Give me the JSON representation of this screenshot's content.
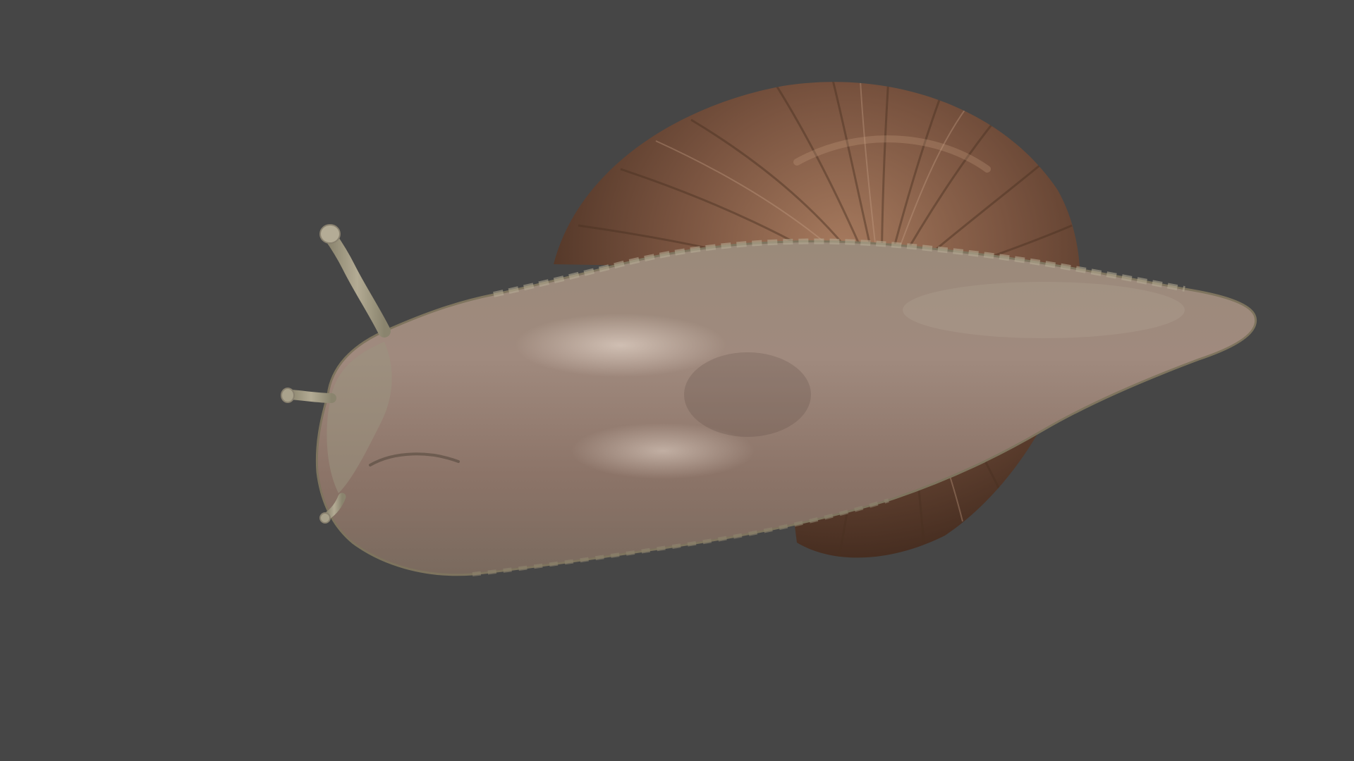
{
  "scene": {
    "subject": "snail-render",
    "colors": {
      "background": "#464646",
      "shell_base": "#6e4a36",
      "shell_light": "#a67a5e",
      "shell_dark": "#3f281c",
      "body_base": "#8e7a6e",
      "body_light": "#bba89a",
      "body_edge": "#9c9480",
      "tentacle": "#a39a82"
    }
  }
}
